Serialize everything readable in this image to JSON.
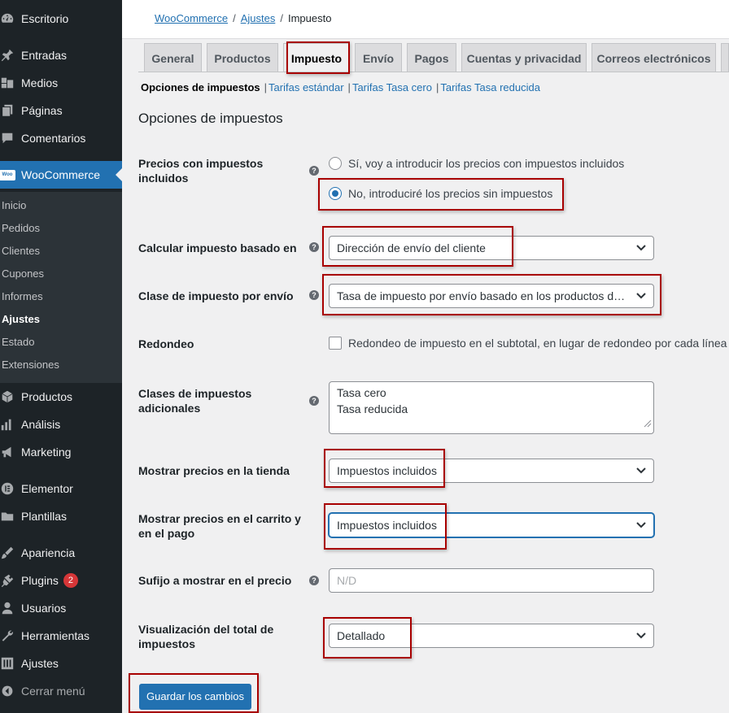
{
  "sidebar": {
    "items": [
      {
        "label": "Escritorio",
        "icon": "dashboard-icon"
      },
      {
        "label": "Entradas",
        "icon": "pin-icon"
      },
      {
        "label": "Medios",
        "icon": "media-icon"
      },
      {
        "label": "Páginas",
        "icon": "pages-icon"
      },
      {
        "label": "Comentarios",
        "icon": "comments-icon"
      },
      {
        "label": "WooCommerce",
        "icon": "woocommerce-icon"
      },
      {
        "label": "Productos",
        "icon": "products-icon"
      },
      {
        "label": "Análisis",
        "icon": "analytics-icon"
      },
      {
        "label": "Marketing",
        "icon": "megaphone-icon"
      },
      {
        "label": "Elementor",
        "icon": "elementor-icon"
      },
      {
        "label": "Plantillas",
        "icon": "folder-icon"
      },
      {
        "label": "Apariencia",
        "icon": "brush-icon"
      },
      {
        "label": "Plugins",
        "icon": "plugin-icon",
        "badge": "2"
      },
      {
        "label": "Usuarios",
        "icon": "users-icon"
      },
      {
        "label": "Herramientas",
        "icon": "wrench-icon"
      },
      {
        "label": "Ajustes",
        "icon": "settings-icon"
      },
      {
        "label": "Cerrar menú",
        "icon": "collapse-icon"
      }
    ],
    "woo_logo_text": "Woo",
    "submenu": [
      "Inicio",
      "Pedidos",
      "Clientes",
      "Cupones",
      "Informes",
      "Ajustes",
      "Estado",
      "Extensiones"
    ]
  },
  "breadcrumb": {
    "root": "WooCommerce",
    "sep": "/",
    "parent": "Ajustes",
    "current": "Impuesto"
  },
  "tabs": [
    "General",
    "Productos",
    "Impuesto",
    "Envío",
    "Pagos",
    "Cuentas y privacidad",
    "Correos electrónicos"
  ],
  "subsub": {
    "current": "Opciones de impuestos",
    "links": [
      "Tarifas estándar",
      "Tarifas Tasa cero",
      "Tarifas Tasa reducida"
    ],
    "sep": "|"
  },
  "section_title": "Opciones de impuestos",
  "help_glyph": "?",
  "form": {
    "prices_incl": {
      "label": "Precios con impuestos incluidos",
      "option_yes": "Sí, voy a introducir los precios con impuestos incluidos",
      "option_no": "No, introduciré los precios sin impuestos"
    },
    "tax_based_on": {
      "label": "Calcular impuesto basado en",
      "value": "Dirección de envío del cliente"
    },
    "shipping_tax_class": {
      "label": "Clase de impuesto por envío",
      "value": "Tasa de impuesto por envío basado en los productos del carrito"
    },
    "rounding": {
      "label": "Redondeo",
      "checkbox_label": "Redondeo de impuesto en el subtotal, en lugar de redondeo por cada línea"
    },
    "additional_classes": {
      "label": "Clases de impuestos adicionales",
      "lines": [
        "Tasa cero",
        "Tasa reducida"
      ]
    },
    "display_shop": {
      "label": "Mostrar precios en la tienda",
      "value": "Impuestos incluidos"
    },
    "display_cart": {
      "label": "Mostrar precios en el carrito y en el pago",
      "value": "Impuestos incluidos"
    },
    "suffix": {
      "label": "Sufijo a mostrar en el precio",
      "placeholder": "N/D"
    },
    "tax_total_display": {
      "label": "Visualización del total de impuestos",
      "value": "Detallado"
    }
  },
  "save_button": "Guardar los cambios",
  "colors": {
    "accent": "#2271b1",
    "sidebar": "#1d2327",
    "highlight": "#a80000"
  }
}
